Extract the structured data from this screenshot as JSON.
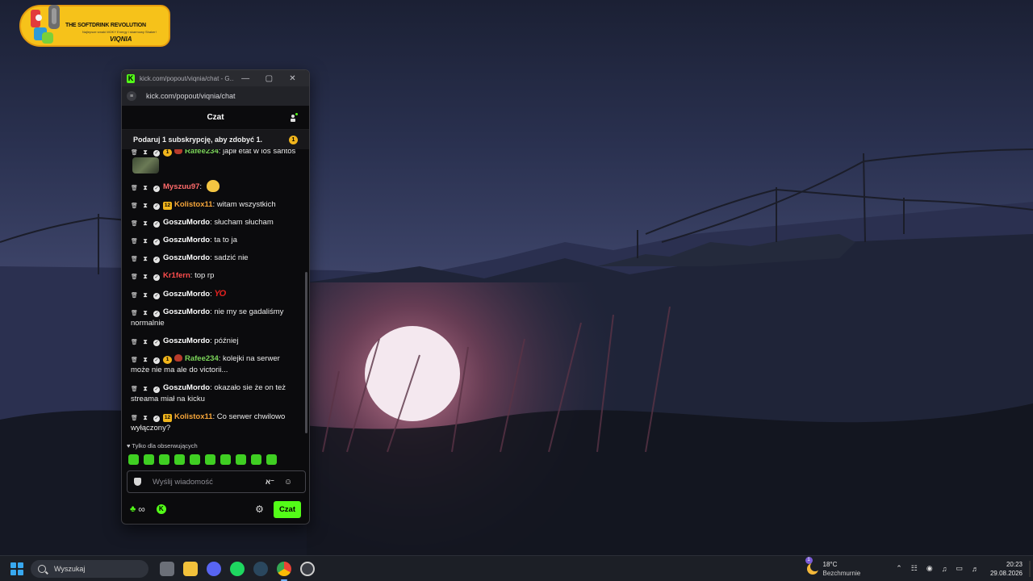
{
  "banner": {
    "title": "THE SOFTDRINK REVOLUTION",
    "subtitle": "Najlepsze smaki MOKY Energy i skarmowy Shaker!",
    "name": "VIQNIA"
  },
  "window": {
    "tab_title": "kick.com/popout/viqnia/chat - G...",
    "url": "kick.com/popout/viqnia/chat",
    "minimize": "—",
    "maximize": "▢",
    "close": "✕"
  },
  "chat": {
    "title": "Czat",
    "pinned_text": "Podaruj 1 subskrypcję, aby zdobyć 1.",
    "pinned_badge": "1",
    "messages": [
      {
        "user": "Rafee234",
        "color": "#7cd65a",
        "text": " japił etat w los santos",
        "sub": "1",
        "round": true,
        "mask": true,
        "emote": "frog"
      },
      {
        "user": "Myszuu97",
        "color": "#ff6b6b",
        "text": " ",
        "emote": "duck"
      },
      {
        "user": "Kolistox11",
        "color": "#f5a53a",
        "text": " witam wszystkich",
        "sub": "12"
      },
      {
        "user": "GoszuMordo",
        "color": "#ffffff",
        "text": " słucham słucham"
      },
      {
        "user": "GoszuMordo",
        "color": "#ffffff",
        "text": " ta to ja"
      },
      {
        "user": "GoszuMordo",
        "color": "#ffffff",
        "text": " sadzić nie"
      },
      {
        "user": "Kr1fern",
        "color": "#ff4d4d",
        "text": " top rp",
        "no_check": true
      },
      {
        "user": "GoszuMordo",
        "color": "#ffffff",
        "text": " ",
        "emote": "yo"
      },
      {
        "user": "GoszuMordo",
        "color": "#ffffff",
        "text": " nie my se gadaliśmy normalnie"
      },
      {
        "user": "GoszuMordo",
        "color": "#ffffff",
        "text": " później"
      },
      {
        "user": "Rafee234",
        "color": "#7cd65a",
        "text": " kolejki na serwer może nie ma ale do victorii...",
        "sub": "1",
        "round": true,
        "mask": true
      },
      {
        "user": "GoszuMordo",
        "color": "#ffffff",
        "text": " okazało sie że on też streama miał na kicku"
      },
      {
        "user": "Kolistox11",
        "color": "#f5a53a",
        "text": " Co serwer chwilowo wyłączony?",
        "sub": "12"
      }
    ],
    "emote_yo": "YO",
    "follow_note": "♥ Tylko dla obserwujących",
    "input_placeholder": "Wyślij wiadomość",
    "send_label": "Czat",
    "infinity": "∞",
    "kick_coin": "K"
  },
  "taskbar": {
    "search_label": "Wyszukaj",
    "weather_temp": "18°C",
    "weather_condition": "Bezchmurnie",
    "weather_badge": "1",
    "time": "20:23",
    "date": "29.08.2026"
  },
  "colors": {
    "kick_green": "#53fc18",
    "sub_badge": "#f1b51c"
  }
}
